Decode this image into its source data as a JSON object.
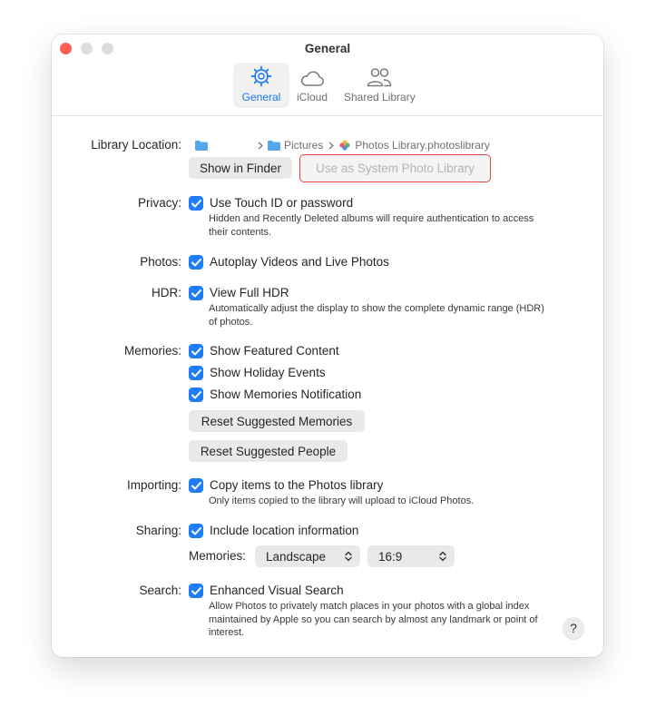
{
  "window": {
    "title": "General"
  },
  "tabs": [
    {
      "label": "General",
      "icon": "gear-icon"
    },
    {
      "label": "iCloud",
      "icon": "cloud-icon"
    },
    {
      "label": "Shared Library",
      "icon": "people-icon"
    }
  ],
  "colors": {
    "accent": "#1f7dfa",
    "close": "#ff5f57",
    "highlight_border": "#e34545"
  },
  "library_location": {
    "label": "Library Location:",
    "path_folder": "Pictures",
    "path_library": "Photos Library.photoslibrary",
    "show_in_finder": "Show in Finder",
    "use_as_system": "Use as System Photo Library"
  },
  "privacy": {
    "label": "Privacy:",
    "option": "Use Touch ID or password",
    "desc": "Hidden and Recently Deleted albums will require authentication to access their contents."
  },
  "photos": {
    "label": "Photos:",
    "option": "Autoplay Videos and Live Photos"
  },
  "hdr": {
    "label": "HDR:",
    "option": "View Full HDR",
    "desc": "Automatically adjust the display to show the complete dynamic range (HDR) of photos."
  },
  "memories": {
    "label": "Memories:",
    "options": [
      "Show Featured Content",
      "Show Holiday Events",
      "Show Memories Notification"
    ],
    "reset_memories": "Reset Suggested Memories",
    "reset_people": "Reset Suggested People"
  },
  "importing": {
    "label": "Importing:",
    "option": "Copy items to the Photos library",
    "desc": "Only items copied to the library will upload to iCloud Photos."
  },
  "sharing": {
    "label": "Sharing:",
    "option": "Include location information",
    "memories_label": "Memories:",
    "orientation": "Landscape",
    "aspect": "16:9"
  },
  "search": {
    "label": "Search:",
    "option": "Enhanced Visual Search",
    "desc": "Allow Photos to privately match places in your photos with a global index maintained by Apple so you can search by almost any landmark or point of interest."
  },
  "help": {
    "label": "?"
  }
}
